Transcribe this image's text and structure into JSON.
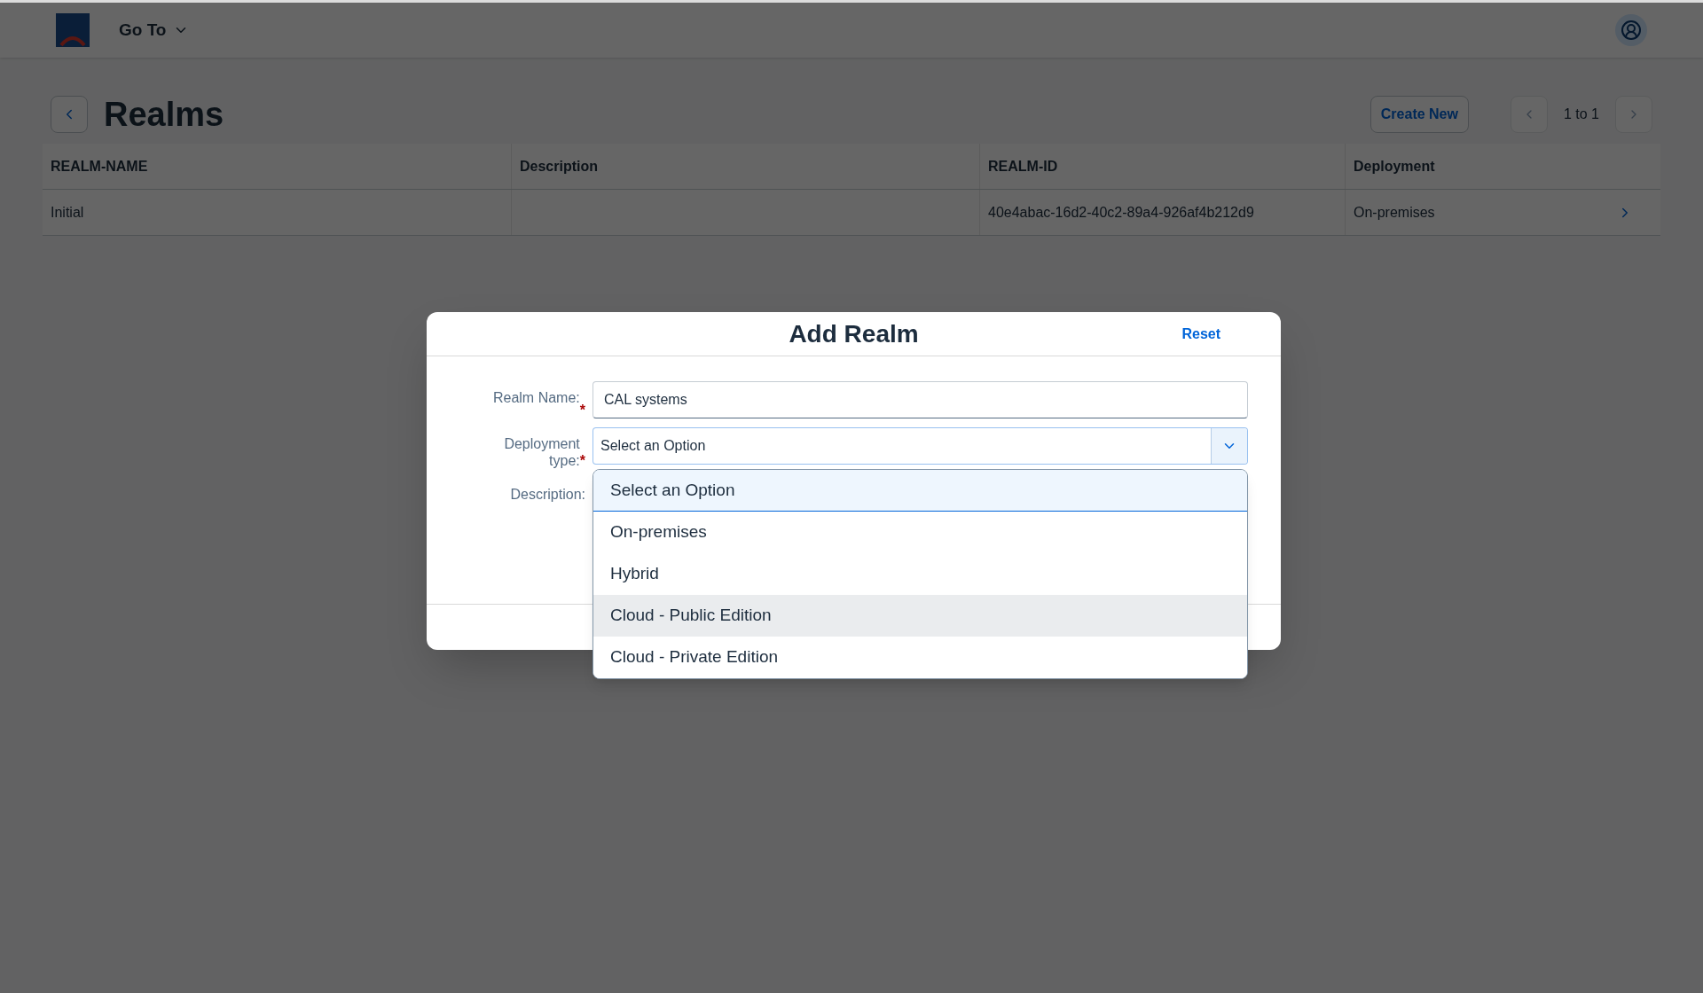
{
  "header": {
    "menu_label": "Go To"
  },
  "page": {
    "title": "Realms",
    "create_button": "Create New",
    "pagination": "1 to 1"
  },
  "table": {
    "columns": [
      "REALM-NAME",
      "Description",
      "REALM-ID",
      "Deployment"
    ],
    "rows": [
      {
        "realm_name": "Initial",
        "realm_id": "40e4abac-16d2-40c2-89a4-926af4b212d9",
        "deployment": "On-premises"
      }
    ]
  },
  "dialog": {
    "title": "Add Realm",
    "reset": "Reset",
    "fields": [
      {
        "kind": "text",
        "label": "Realm Name:",
        "required_mark": "*",
        "value": "CAL systems"
      },
      {
        "kind": "select",
        "label": "Deployment type:",
        "required_mark": "*",
        "value": "Select an Option",
        "expanded": true,
        "options": [
          {
            "label": "Select an Option",
            "selected": true,
            "highlighted": false
          },
          {
            "label": "On-premises",
            "selected": false,
            "highlighted": false
          },
          {
            "label": "Hybrid",
            "selected": false,
            "highlighted": false
          },
          {
            "label": "Cloud - Public Edition",
            "selected": false,
            "highlighted": true
          },
          {
            "label": "Cloud - Private Edition",
            "selected": false,
            "highlighted": false
          }
        ]
      },
      {
        "kind": "textarea",
        "label": "Description:"
      }
    ]
  }
}
